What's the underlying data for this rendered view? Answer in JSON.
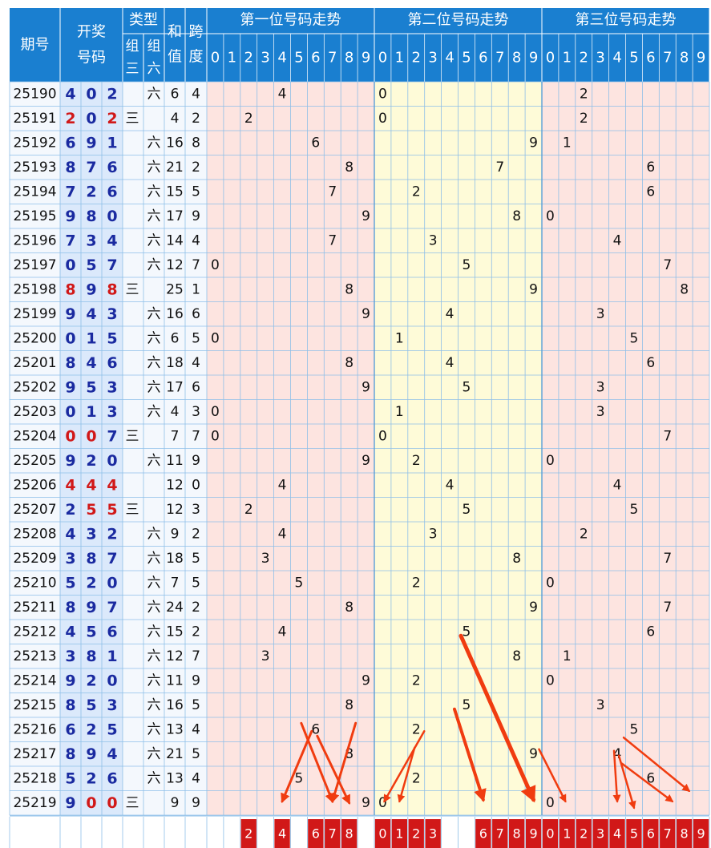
{
  "chart_data": {
    "type": "table",
    "headers": {
      "period": "期号",
      "draw_line1": "开奖",
      "draw_line2": "号码",
      "type_title": "类型",
      "type_sub1": [
        "组",
        "三"
      ],
      "type_sub2": [
        "组",
        "六"
      ],
      "sum": [
        "和",
        "值"
      ],
      "span": [
        "跨",
        "度"
      ],
      "pos1": "第一位号码走势",
      "pos2": "第二位号码走势",
      "pos3": "第三位号码走势",
      "digits": [
        "0",
        "1",
        "2",
        "3",
        "4",
        "5",
        "6",
        "7",
        "8",
        "9"
      ]
    },
    "rows": [
      {
        "period": "25190",
        "digits": [
          4,
          0,
          2
        ],
        "type": "六",
        "sum": 6,
        "span": 4
      },
      {
        "period": "25191",
        "digits": [
          2,
          0,
          2
        ],
        "type": "三",
        "sum": 4,
        "span": 2
      },
      {
        "period": "25192",
        "digits": [
          6,
          9,
          1
        ],
        "type": "六",
        "sum": 16,
        "span": 8
      },
      {
        "period": "25193",
        "digits": [
          8,
          7,
          6
        ],
        "type": "六",
        "sum": 21,
        "span": 2
      },
      {
        "period": "25194",
        "digits": [
          7,
          2,
          6
        ],
        "type": "六",
        "sum": 15,
        "span": 5
      },
      {
        "period": "25195",
        "digits": [
          9,
          8,
          0
        ],
        "type": "六",
        "sum": 17,
        "span": 9
      },
      {
        "period": "25196",
        "digits": [
          7,
          3,
          4
        ],
        "type": "六",
        "sum": 14,
        "span": 4
      },
      {
        "period": "25197",
        "digits": [
          0,
          5,
          7
        ],
        "type": "六",
        "sum": 12,
        "span": 7
      },
      {
        "period": "25198",
        "digits": [
          8,
          9,
          8
        ],
        "type": "三",
        "sum": 25,
        "span": 1
      },
      {
        "period": "25199",
        "digits": [
          9,
          4,
          3
        ],
        "type": "六",
        "sum": 16,
        "span": 6
      },
      {
        "period": "25200",
        "digits": [
          0,
          1,
          5
        ],
        "type": "六",
        "sum": 6,
        "span": 5
      },
      {
        "period": "25201",
        "digits": [
          8,
          4,
          6
        ],
        "type": "六",
        "sum": 18,
        "span": 4
      },
      {
        "period": "25202",
        "digits": [
          9,
          5,
          3
        ],
        "type": "六",
        "sum": 17,
        "span": 6
      },
      {
        "period": "25203",
        "digits": [
          0,
          1,
          3
        ],
        "type": "六",
        "sum": 4,
        "span": 3
      },
      {
        "period": "25204",
        "digits": [
          0,
          0,
          7
        ],
        "type": "三",
        "sum": 7,
        "span": 7
      },
      {
        "period": "25205",
        "digits": [
          9,
          2,
          0
        ],
        "type": "六",
        "sum": 11,
        "span": 9
      },
      {
        "period": "25206",
        "digits": [
          4,
          4,
          4
        ],
        "type": "",
        "sum": 12,
        "span": 0
      },
      {
        "period": "25207",
        "digits": [
          2,
          5,
          5
        ],
        "type": "三",
        "sum": 12,
        "span": 3
      },
      {
        "period": "25208",
        "digits": [
          4,
          3,
          2
        ],
        "type": "六",
        "sum": 9,
        "span": 2
      },
      {
        "period": "25209",
        "digits": [
          3,
          8,
          7
        ],
        "type": "六",
        "sum": 18,
        "span": 5
      },
      {
        "period": "25210",
        "digits": [
          5,
          2,
          0
        ],
        "type": "六",
        "sum": 7,
        "span": 5
      },
      {
        "period": "25211",
        "digits": [
          8,
          9,
          7
        ],
        "type": "六",
        "sum": 24,
        "span": 2
      },
      {
        "period": "25212",
        "digits": [
          4,
          5,
          6
        ],
        "type": "六",
        "sum": 15,
        "span": 2
      },
      {
        "period": "25213",
        "digits": [
          3,
          8,
          1
        ],
        "type": "六",
        "sum": 12,
        "span": 7
      },
      {
        "period": "25214",
        "digits": [
          9,
          2,
          0
        ],
        "type": "六",
        "sum": 11,
        "span": 9
      },
      {
        "period": "25215",
        "digits": [
          8,
          5,
          3
        ],
        "type": "六",
        "sum": 16,
        "span": 5
      },
      {
        "period": "25216",
        "digits": [
          6,
          2,
          5
        ],
        "type": "六",
        "sum": 13,
        "span": 4
      },
      {
        "period": "25217",
        "digits": [
          8,
          9,
          4
        ],
        "type": "六",
        "sum": 21,
        "span": 5
      },
      {
        "period": "25218",
        "digits": [
          5,
          2,
          6
        ],
        "type": "六",
        "sum": 13,
        "span": 4
      },
      {
        "period": "25219",
        "digits": [
          9,
          0,
          0
        ],
        "type": "三",
        "sum": 9,
        "span": 9
      }
    ],
    "predictions": {
      "pos1": [
        2,
        4,
        6,
        7,
        8
      ],
      "pos2": [
        0,
        1,
        2,
        3,
        6,
        7,
        8,
        9
      ],
      "pos3": [
        0,
        1,
        2,
        3,
        4,
        5,
        6,
        7,
        8,
        9
      ]
    },
    "colors": {
      "header": "#1a7fd0",
      "left_bg": "#dbe9fb",
      "pos1_bg": "#fde4e0",
      "pos2_bg": "#fefbd8",
      "pos3_bg": "#fde4e0",
      "grid": "#8ebfe8",
      "digit_normal": "#1a2aa0",
      "digit_pair": "#d11818",
      "prediction_bg": "#d11818",
      "arrow": "#f03c10"
    }
  }
}
